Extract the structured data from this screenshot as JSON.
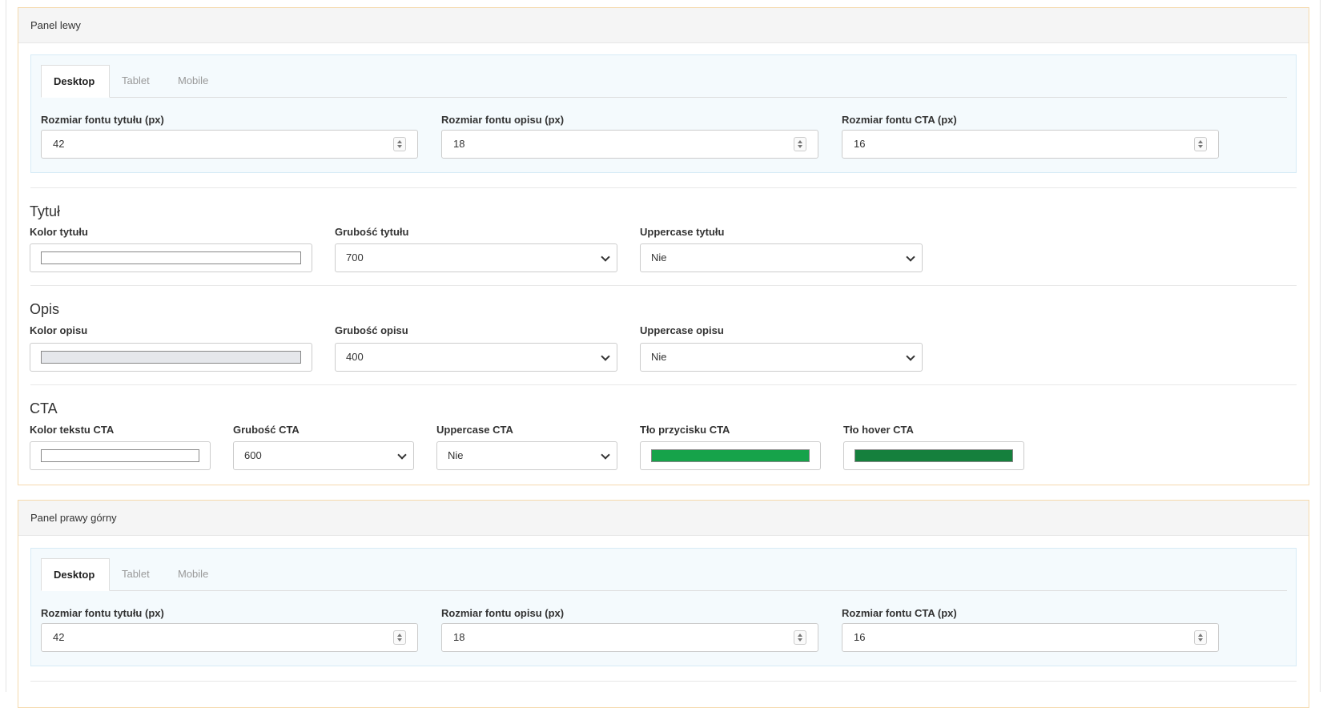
{
  "panels": [
    {
      "title": "Panel lewy",
      "tabs": [
        "Desktop",
        "Tablet",
        "Mobile"
      ],
      "active_tab": "Desktop",
      "font_sizes": [
        {
          "label": "Rozmiar fontu tytułu (px)",
          "value": "42"
        },
        {
          "label": "Rozmiar fontu opisu (px)",
          "value": "18"
        },
        {
          "label": "Rozmiar fontu CTA (px)",
          "value": "16"
        }
      ],
      "title_section": {
        "heading": "Tytuł",
        "color_label": "Kolor tytułu",
        "color_value": "#ffffff",
        "weight_label": "Grubość tytułu",
        "weight_value": "700",
        "uppercase_label": "Uppercase tytułu",
        "uppercase_value": "Nie"
      },
      "desc_section": {
        "heading": "Opis",
        "color_label": "Kolor opisu",
        "color_value": "#e5e7eb",
        "weight_label": "Grubość opisu",
        "weight_value": "400",
        "uppercase_label": "Uppercase opisu",
        "uppercase_value": "Nie"
      },
      "cta_section": {
        "heading": "CTA",
        "text_color_label": "Kolor tekstu CTA",
        "text_color_value": "#ffffff",
        "weight_label": "Grubość CTA",
        "weight_value": "600",
        "uppercase_label": "Uppercase CTA",
        "uppercase_value": "Nie",
        "bg_label": "Tło przycisku CTA",
        "bg_value": "#16a34a",
        "hover_label": "Tło hover CTA",
        "hover_value": "#15803d"
      }
    },
    {
      "title": "Panel prawy górny",
      "tabs": [
        "Desktop",
        "Tablet",
        "Mobile"
      ],
      "active_tab": "Desktop",
      "font_sizes": [
        {
          "label": "Rozmiar fontu tytułu (px)",
          "value": "42"
        },
        {
          "label": "Rozmiar fontu opisu (px)",
          "value": "18"
        },
        {
          "label": "Rozmiar fontu CTA (px)",
          "value": "16"
        }
      ]
    }
  ]
}
